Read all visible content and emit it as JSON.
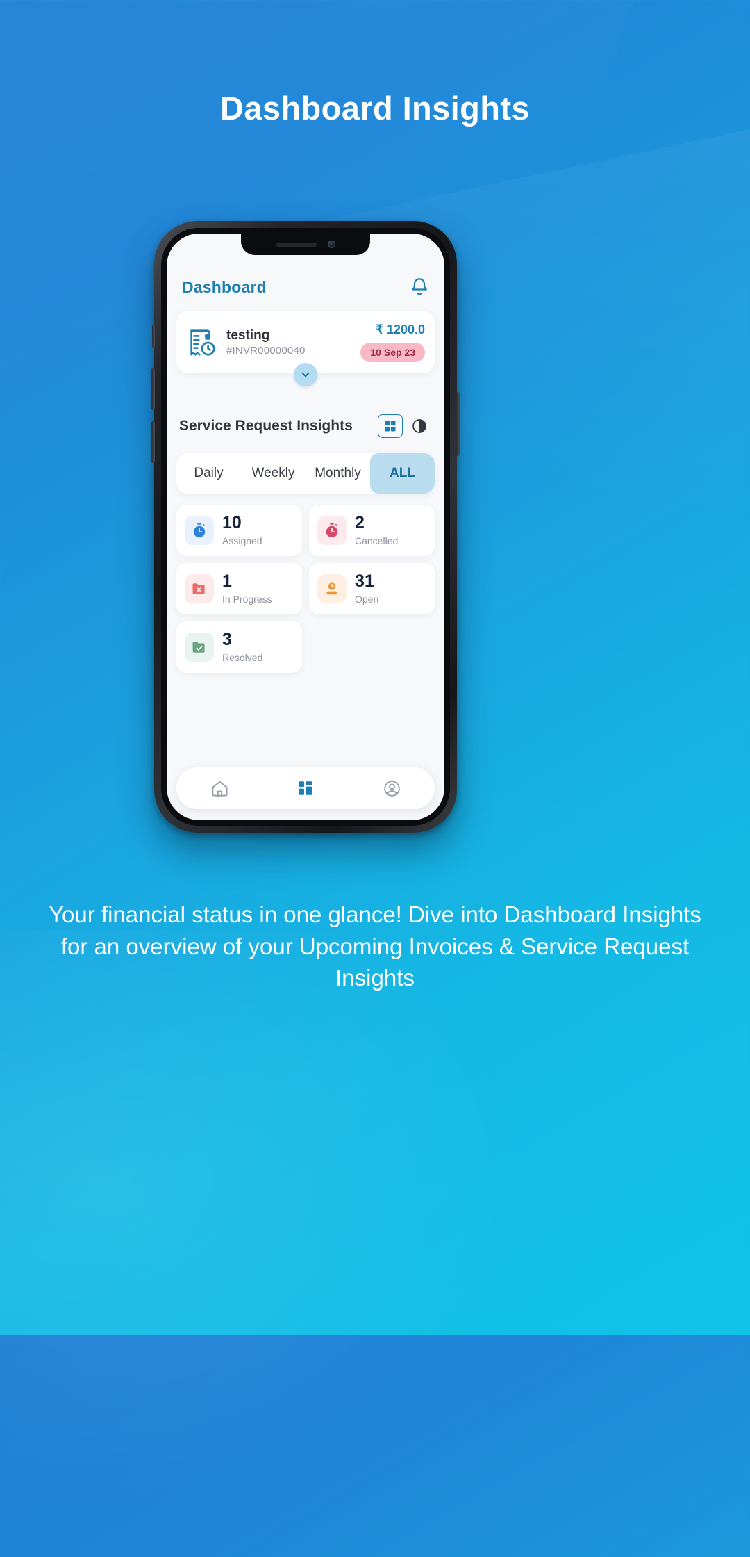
{
  "banner": {
    "title": "Dashboard Insights",
    "caption": "Your financial status in one glance! Dive into Dashboard Insights for an overview of your Upcoming Invoices & Service Request Insights",
    "background_color": "#1a95dc"
  },
  "app": {
    "header": {
      "title": "Dashboard",
      "title_color": "#1d7fb0",
      "notification_icon": "bell-icon"
    },
    "invoice_card": {
      "icon": "invoice-clock-icon",
      "name": "testing",
      "number": "#INVR00000040",
      "amount": "₹ 1200.0",
      "amount_color": "#1d7fb0",
      "date_badge": "10 Sep 23",
      "date_badge_bg": "#f9b8c6",
      "date_badge_color": "#9d2b46",
      "expand_icon": "chevron-down-icon"
    },
    "insights": {
      "title": "Service Request Insights",
      "view_toggle": [
        {
          "name": "grid-view-icon",
          "active": true
        },
        {
          "name": "pie-chart-view-icon",
          "active": false
        }
      ],
      "periods": [
        {
          "label": "Daily",
          "active": false
        },
        {
          "label": "Weekly",
          "active": false
        },
        {
          "label": "Monthly",
          "active": false
        },
        {
          "label": "ALL",
          "active": true
        }
      ],
      "active_period_bg": "#b9dcee",
      "stats": [
        {
          "value": "10",
          "label": "Assigned",
          "icon": "stopwatch-blue-icon",
          "icon_bg": "#e9f2fc",
          "icon_color": "#2f82d8"
        },
        {
          "value": "2",
          "label": "Cancelled",
          "icon": "stopwatch-red-icon",
          "icon_bg": "#fdeaef",
          "icon_color": "#d24a6a"
        },
        {
          "value": "1",
          "label": "In Progress",
          "icon": "folder-cancel-icon",
          "icon_bg": "#fdeaea",
          "icon_color": "#ec6a6a"
        },
        {
          "value": "31",
          "label": "Open",
          "icon": "clock-person-icon",
          "icon_bg": "#fdf0e2",
          "icon_color": "#f09434"
        },
        {
          "value": "3",
          "label": "Resolved",
          "icon": "folder-check-icon",
          "icon_bg": "#eaf4ee",
          "icon_color": "#6aa583"
        }
      ]
    },
    "bottom_nav": [
      {
        "name": "home-icon",
        "active": false
      },
      {
        "name": "dashboard-icon",
        "active": true
      },
      {
        "name": "profile-icon",
        "active": false
      }
    ],
    "nav_active_color": "#1d7fb0"
  }
}
